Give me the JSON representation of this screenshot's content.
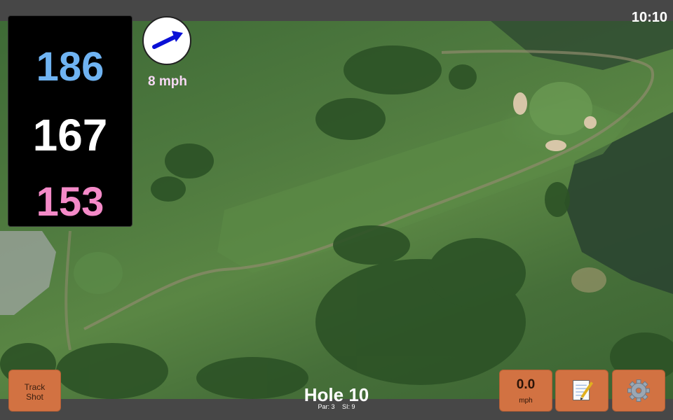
{
  "status": {
    "time": "10:10"
  },
  "distances": {
    "back": "186",
    "middle": "167",
    "front": "153"
  },
  "wind": {
    "speed": "8 mph",
    "icon": "wind-direction-arrow-icon",
    "arrow_color": "#0a10d6"
  },
  "hole": {
    "title": "Hole 10",
    "par": "Par: 3",
    "si": "SI: 9"
  },
  "buttons": {
    "track_shot": {
      "line1": "Track",
      "line2": "Shot"
    },
    "speed": {
      "value": "0.0",
      "unit": "mph"
    },
    "notes": {
      "icon": "notepad-icon"
    },
    "settings": {
      "icon": "gear-icon"
    }
  },
  "colors": {
    "accent_button": "#d27242",
    "back_distance": "#6fb3f2",
    "middle_distance": "#ffffff",
    "front_distance": "#f48ac8",
    "bar": "#474747"
  }
}
